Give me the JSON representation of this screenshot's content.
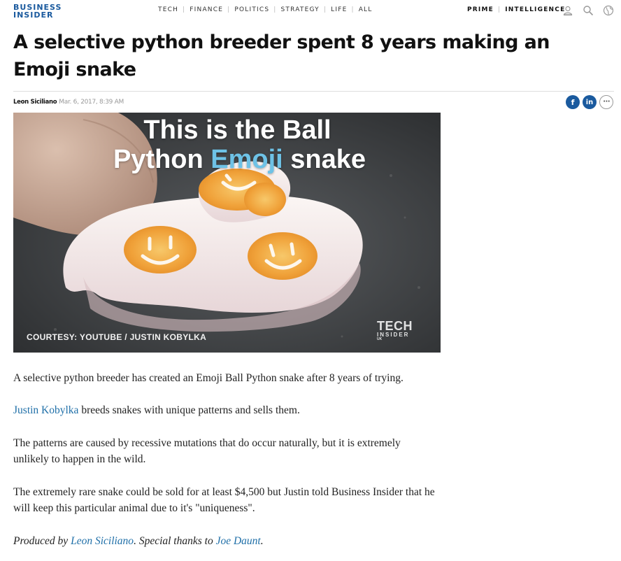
{
  "header": {
    "logo_line1": "BUSINESS",
    "logo_line2": "INSIDER",
    "nav": [
      "TECH",
      "FINANCE",
      "POLITICS",
      "STRATEGY",
      "LIFE",
      "ALL"
    ],
    "right_nav": [
      "PRIME",
      "INTELLIGENCE"
    ],
    "icons": [
      "user-icon",
      "search-icon",
      "globe-icon"
    ],
    "brand_color": "#1a5a9e"
  },
  "article": {
    "headline": "A selective python breeder spent 8 years making an Emoji snake",
    "author": "Leon Siciliano",
    "date": "Mar. 6, 2017, 8:39 AM",
    "share": {
      "facebook": "f",
      "linkedin": "in",
      "more": "⋯"
    },
    "hero": {
      "title_line1": "This is the Ball",
      "title_line2_a": "Python ",
      "title_line2_emoji": "Emoji",
      "title_line2_b": " snake",
      "credit": "COURTESY: YOUTUBE / JUSTIN KOBYLKA",
      "watermark_1": "TECH",
      "watermark_2": "INSIDER",
      "watermark_3": "UK"
    },
    "paragraphs": {
      "p1": "A selective python breeder has created an Emoji Ball Python snake after 8 years of trying.",
      "p2_link": "Justin Kobylka",
      "p2_rest": " breeds snakes with unique patterns and sells them.",
      "p3": "The patterns are caused by recessive mutations that do occur naturally, but it is extremely unlikely to happen in the wild.",
      "p4": "The extremely rare snake could be sold for at least $4,500 but Justin told Business Insider that he will keep this particular animal due to it's \"uniqueness\".",
      "p5_a": "Produced by ",
      "p5_link1": "Leon Siciliano",
      "p5_b": ". Special thanks to ",
      "p5_link2": "Joe Daunt",
      "p5_c": "."
    },
    "link_color": "#1f6fa8"
  }
}
